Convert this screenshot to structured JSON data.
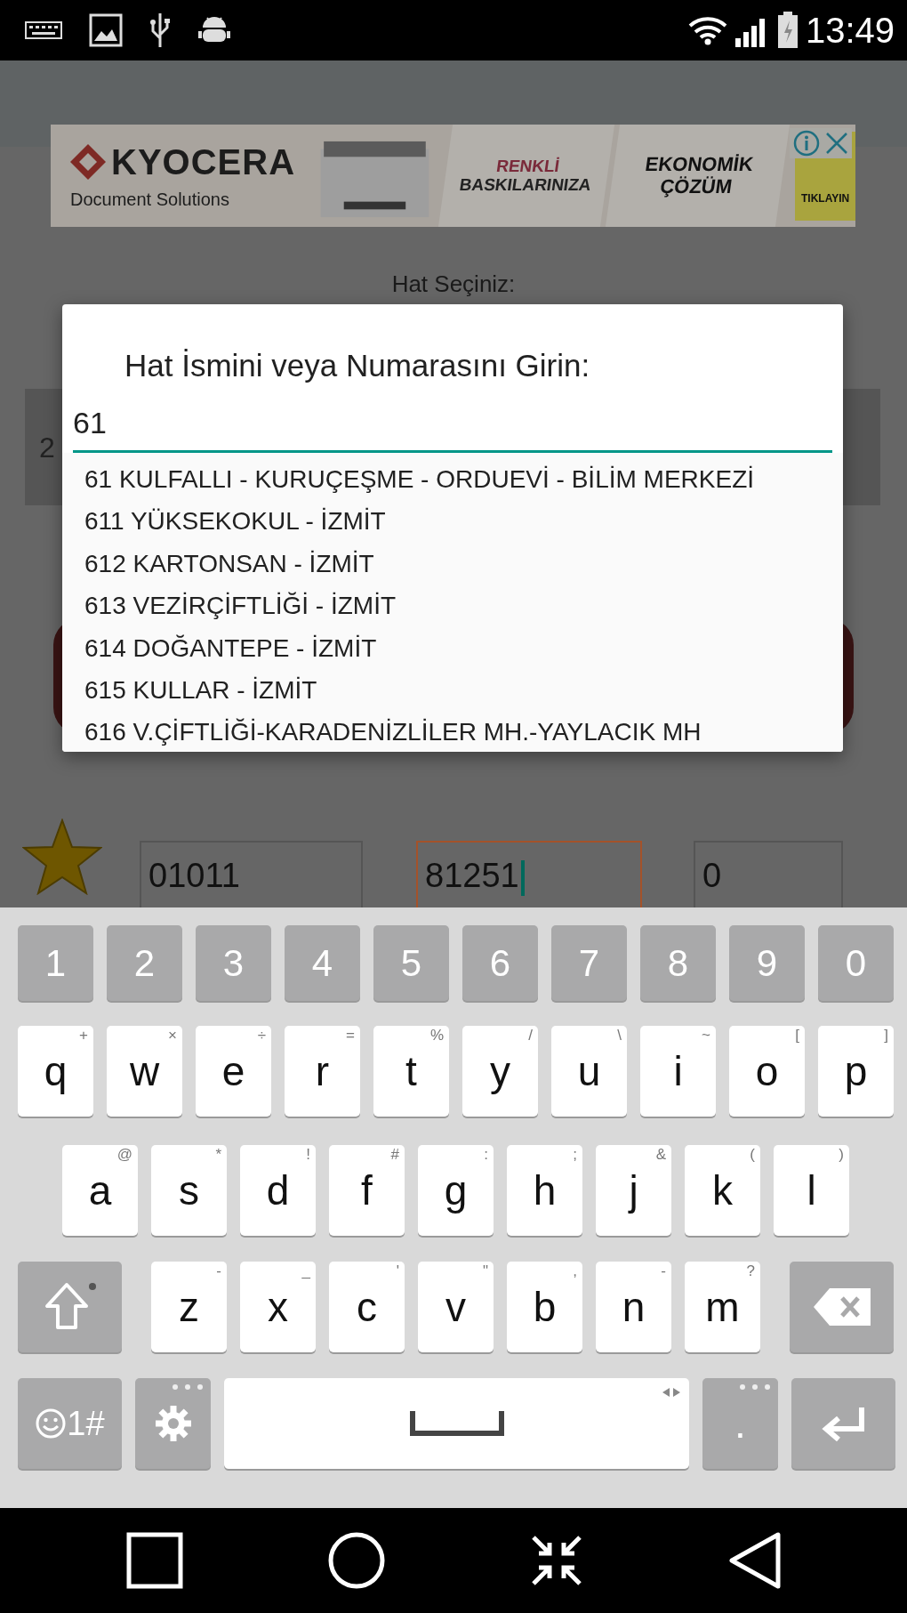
{
  "status_bar": {
    "time": "13:49"
  },
  "ad": {
    "brand": "KYOCERA",
    "tagline": "Document Solutions",
    "headline": "RENKLİ",
    "subline": "BASKILARINIZA",
    "offer": [
      "EKONOMİK",
      "ÇÖZÜM"
    ],
    "cta": "TIKLAYIN"
  },
  "background": {
    "label": "Hat Seçiniz:",
    "selector_value": "2",
    "fields": [
      {
        "value": "01011",
        "focused": false
      },
      {
        "value": "81251",
        "focused": true
      },
      {
        "value": "0",
        "focused": false
      }
    ]
  },
  "dialog": {
    "title": "Hat İsmini veya Numarasını Girin:",
    "input": {
      "value": "61"
    },
    "suggestions": [
      "61 KULFALLI - KURUÇEŞME - ORDUEVİ - BİLİM MERKEZİ",
      "611 YÜKSEKOKUL - İZMİT",
      "612 KARTONSAN - İZMİT",
      "613 VEZİRÇİFTLİĞİ - İZMİT",
      "614 DOĞANTEPE - İZMİT",
      "615 KULLAR - İZMİT",
      "616 V.ÇİFTLİĞİ-KARADENİZLİLER MH.-YAYLACIK MH"
    ]
  },
  "keyboard": {
    "rows": [
      [
        {
          "kind": "digit",
          "label": "1"
        },
        {
          "kind": "digit",
          "label": "2"
        },
        {
          "kind": "digit",
          "label": "3"
        },
        {
          "kind": "digit",
          "label": "4"
        },
        {
          "kind": "digit",
          "label": "5"
        },
        {
          "kind": "digit",
          "label": "6"
        },
        {
          "kind": "digit",
          "label": "7"
        },
        {
          "kind": "digit",
          "label": "8"
        },
        {
          "kind": "digit",
          "label": "9"
        },
        {
          "kind": "digit",
          "label": "0"
        }
      ],
      [
        {
          "kind": "letter",
          "label": "q",
          "hint": "+"
        },
        {
          "kind": "letter",
          "label": "w",
          "hint": "×"
        },
        {
          "kind": "letter",
          "label": "e",
          "hint": "÷"
        },
        {
          "kind": "letter",
          "label": "r",
          "hint": "="
        },
        {
          "kind": "letter",
          "label": "t",
          "hint": "%"
        },
        {
          "kind": "letter",
          "label": "y",
          "hint": "/"
        },
        {
          "kind": "letter",
          "label": "u",
          "hint": "\\"
        },
        {
          "kind": "letter",
          "label": "i",
          "hint": "~"
        },
        {
          "kind": "letter",
          "label": "o",
          "hint": "["
        },
        {
          "kind": "letter",
          "label": "p",
          "hint": "]"
        }
      ],
      [
        {
          "kind": "letter",
          "label": "a",
          "hint": "@"
        },
        {
          "kind": "letter",
          "label": "s",
          "hint": "*"
        },
        {
          "kind": "letter",
          "label": "d",
          "hint": "!"
        },
        {
          "kind": "letter",
          "label": "f",
          "hint": "#"
        },
        {
          "kind": "letter",
          "label": "g",
          "hint": ":"
        },
        {
          "kind": "letter",
          "label": "h",
          "hint": ";"
        },
        {
          "kind": "letter",
          "label": "j",
          "hint": "&"
        },
        {
          "kind": "letter",
          "label": "k",
          "hint": "("
        },
        {
          "kind": "letter",
          "label": "l",
          "hint": ")"
        }
      ],
      [
        {
          "kind": "shift"
        },
        {
          "kind": "letter",
          "label": "z",
          "hint": "-"
        },
        {
          "kind": "letter",
          "label": "x",
          "hint": "_"
        },
        {
          "kind": "letter",
          "label": "c",
          "hint": "'"
        },
        {
          "kind": "letter",
          "label": "v",
          "hint": "\""
        },
        {
          "kind": "letter",
          "label": "b",
          "hint": ","
        },
        {
          "kind": "letter",
          "label": "n",
          "hint": "-"
        },
        {
          "kind": "letter",
          "label": "m",
          "hint": "?"
        },
        {
          "kind": "backspace"
        }
      ],
      [
        {
          "kind": "symbols",
          "label": "1#"
        },
        {
          "kind": "settings"
        },
        {
          "kind": "space"
        },
        {
          "kind": "period",
          "label": "."
        },
        {
          "kind": "enter"
        }
      ]
    ]
  }
}
